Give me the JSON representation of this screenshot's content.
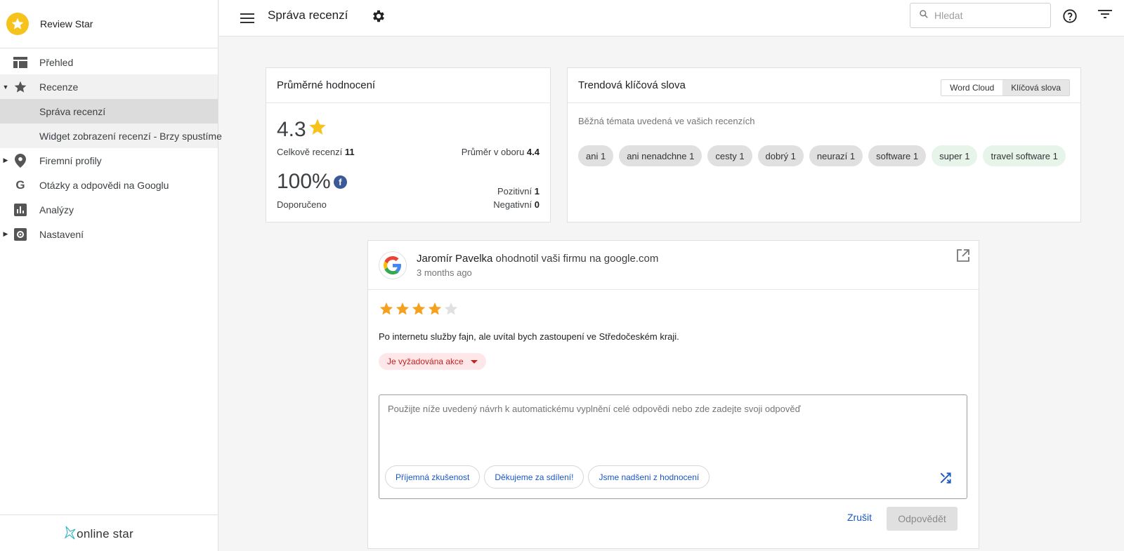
{
  "app": {
    "name": "Review Star",
    "footer_brand": "online star"
  },
  "sidebar": {
    "items": [
      {
        "label": "Přehled",
        "icon": "dashboard-icon"
      },
      {
        "label": "Recenze",
        "icon": "star-icon",
        "expanded": true
      },
      {
        "label": "Správa recenzí",
        "active": true
      },
      {
        "label": "Widget zobrazení recenzí - Brzy spustíme"
      },
      {
        "label": "Firemní profily",
        "icon": "location-pin-icon"
      },
      {
        "label": "Otázky a odpovědi na Googlu",
        "icon": "google-g-icon"
      },
      {
        "label": "Analýzy",
        "icon": "bar-chart-icon"
      },
      {
        "label": "Nastavení",
        "icon": "settings-box-icon"
      }
    ]
  },
  "header": {
    "title": "Správa recenzí",
    "search_placeholder": "Hledat"
  },
  "avg_card": {
    "title": "Průměrné hodnocení",
    "rating": "4.3",
    "total_label": "Celkově recenzí",
    "total_value": "11",
    "industry_label": "Průměr v oboru",
    "industry_value": "4.4",
    "recommended_pct": "100%",
    "recommended_label": "Doporučeno",
    "positive_label": "Pozitivní",
    "positive_value": "1",
    "negative_label": "Negativní",
    "negative_value": "0"
  },
  "trend_card": {
    "title": "Trendová klíčová slova",
    "toggle": [
      "Word Cloud",
      "Klíčová slova"
    ],
    "selected_toggle": "Klíčová slova",
    "subtitle": "Běžná témata uvedená ve vašich recenzích",
    "keywords": [
      {
        "label": "ani 1",
        "sentiment": "neutral"
      },
      {
        "label": "ani nenadchne 1",
        "sentiment": "neutral"
      },
      {
        "label": "cesty 1",
        "sentiment": "neutral"
      },
      {
        "label": "dobrý 1",
        "sentiment": "neutral"
      },
      {
        "label": "neurazí 1",
        "sentiment": "neutral"
      },
      {
        "label": "software 1",
        "sentiment": "neutral"
      },
      {
        "label": "super 1",
        "sentiment": "positive"
      },
      {
        "label": "travel software 1",
        "sentiment": "positive"
      }
    ]
  },
  "review": {
    "author": "Jaromír Pavelka",
    "action_text": "ohodnotil vaši firmu na google.com",
    "time": "3 months ago",
    "rating": 4,
    "max_rating": 5,
    "text": "Po internetu služby fajn, ale uvítal bych zastoupení ve Středočeském kraji.",
    "status": "Je vyžadována akce",
    "reply_placeholder": "Použijte níže uvedený návrh k automatickému vyplnění celé odpovědi nebo zde zadejte svoji odpověď",
    "suggestions": [
      "Příjemná zkušenost",
      "Děkujeme za sdílení!",
      "Jsme nadšeni z hodnocení"
    ],
    "cancel_label": "Zrušit",
    "reply_label": "Odpovědět"
  },
  "colors": {
    "star": "#f6c31d",
    "rating_star": "#f4a11f",
    "link_blue": "#1a56c4",
    "badge_red": "#c5221f"
  }
}
